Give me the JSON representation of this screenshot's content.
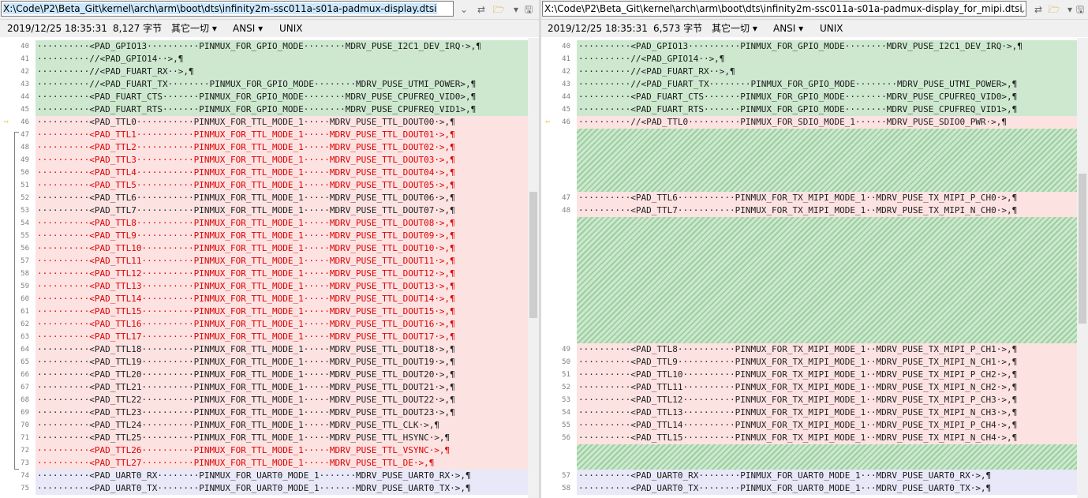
{
  "left": {
    "path": "X:\\Code\\P2\\Beta_Git\\kernel\\arch\\arm\\boot\\dts\\infinity2m-ssc011a-s01a-padmux-display.dtsi",
    "date": "2019/12/25 18:35:31",
    "size": "8,127 字节",
    "charset_menu": "其它一切 ▾",
    "encoding_menu": "ANSI ▾",
    "lineend": "UNIX",
    "lines": [
      {
        "n": "40",
        "t": "··········<PAD_GPIO13··········PINMUX_FOR_GPIO_MODE········MDRV_PUSE_I2C1_DEV_IRQ·>,¶",
        "k": "same"
      },
      {
        "n": "41",
        "t": "··········//<PAD_GPIO14··>,¶",
        "k": "same"
      },
      {
        "n": "42",
        "t": "··········//<PAD_FUART_RX··>,¶",
        "k": "same"
      },
      {
        "n": "43",
        "t": "··········//<PAD_FUART_TX········PINMUX_FOR_GPIO_MODE········MDRV_PUSE_UTMI_POWER>,¶",
        "k": "same"
      },
      {
        "n": "44",
        "t": "··········<PAD_FUART_CTS·······PINMUX_FOR_GPIO_MODE········MDRV_PUSE_CPUFREQ_VID0>,¶",
        "k": "same"
      },
      {
        "n": "45",
        "t": "··········<PAD_FUART_RTS·······PINMUX_FOR_GPIO_MODE········MDRV_PUSE_CPUFREQ_VID1>,¶",
        "k": "same"
      },
      {
        "n": "46",
        "t": "··········<PAD_TTL0···········PINMUX_FOR_TTL_MODE_1·····MDRV_PUSE_TTL_DOUT00·>,¶",
        "k": "diff"
      },
      {
        "n": "47",
        "t": "··········<PAD_TTL1···········PINMUX_FOR_TTL_MODE_1·····MDRV_PUSE_TTL_DOUT01·>,¶",
        "k": "diff red"
      },
      {
        "n": "48",
        "t": "··········<PAD_TTL2···········PINMUX_FOR_TTL_MODE_1·····MDRV_PUSE_TTL_DOUT02·>,¶",
        "k": "diff red"
      },
      {
        "n": "49",
        "t": "··········<PAD_TTL3···········PINMUX_FOR_TTL_MODE_1·····MDRV_PUSE_TTL_DOUT03·>,¶",
        "k": "diff red"
      },
      {
        "n": "50",
        "t": "··········<PAD_TTL4···········PINMUX_FOR_TTL_MODE_1·····MDRV_PUSE_TTL_DOUT04·>,¶",
        "k": "diff red"
      },
      {
        "n": "51",
        "t": "··········<PAD_TTL5···········PINMUX_FOR_TTL_MODE_1·····MDRV_PUSE_TTL_DOUT05·>,¶",
        "k": "diff red"
      },
      {
        "n": "52",
        "t": "··········<PAD_TTL6···········PINMUX_FOR_TTL_MODE_1·····MDRV_PUSE_TTL_DOUT06·>,¶",
        "k": "diff"
      },
      {
        "n": "53",
        "t": "··········<PAD_TTL7···········PINMUX_FOR_TTL_MODE_1·····MDRV_PUSE_TTL_DOUT07·>,¶",
        "k": "diff"
      },
      {
        "n": "54",
        "t": "··········<PAD_TTL8···········PINMUX_FOR_TTL_MODE_1·····MDRV_PUSE_TTL_DOUT08·>,¶",
        "k": "diff red"
      },
      {
        "n": "55",
        "t": "··········<PAD_TTL9···········PINMUX_FOR_TTL_MODE_1·····MDRV_PUSE_TTL_DOUT09·>,¶",
        "k": "diff red"
      },
      {
        "n": "56",
        "t": "··········<PAD_TTL10··········PINMUX_FOR_TTL_MODE_1·····MDRV_PUSE_TTL_DOUT10·>,¶",
        "k": "diff red"
      },
      {
        "n": "57",
        "t": "··········<PAD_TTL11··········PINMUX_FOR_TTL_MODE_1·····MDRV_PUSE_TTL_DOUT11·>,¶",
        "k": "diff red"
      },
      {
        "n": "58",
        "t": "··········<PAD_TTL12··········PINMUX_FOR_TTL_MODE_1·····MDRV_PUSE_TTL_DOUT12·>,¶",
        "k": "diff red"
      },
      {
        "n": "59",
        "t": "··········<PAD_TTL13··········PINMUX_FOR_TTL_MODE_1·····MDRV_PUSE_TTL_DOUT13·>,¶",
        "k": "diff red"
      },
      {
        "n": "60",
        "t": "··········<PAD_TTL14··········PINMUX_FOR_TTL_MODE_1·····MDRV_PUSE_TTL_DOUT14·>,¶",
        "k": "diff red"
      },
      {
        "n": "61",
        "t": "··········<PAD_TTL15··········PINMUX_FOR_TTL_MODE_1·····MDRV_PUSE_TTL_DOUT15·>,¶",
        "k": "diff red"
      },
      {
        "n": "62",
        "t": "··········<PAD_TTL16··········PINMUX_FOR_TTL_MODE_1·····MDRV_PUSE_TTL_DOUT16·>,¶",
        "k": "diff red"
      },
      {
        "n": "63",
        "t": "··········<PAD_TTL17··········PINMUX_FOR_TTL_MODE_1·····MDRV_PUSE_TTL_DOUT17·>,¶",
        "k": "diff red"
      },
      {
        "n": "64",
        "t": "··········<PAD_TTL18··········PINMUX_FOR_TTL_MODE_1·····MDRV_PUSE_TTL_DOUT18·>,¶",
        "k": "diff"
      },
      {
        "n": "65",
        "t": "··········<PAD_TTL19··········PINMUX_FOR_TTL_MODE_1·····MDRV_PUSE_TTL_DOUT19·>,¶",
        "k": "diff"
      },
      {
        "n": "66",
        "t": "··········<PAD_TTL20··········PINMUX_FOR_TTL_MODE_1·····MDRV_PUSE_TTL_DOUT20·>,¶",
        "k": "diff"
      },
      {
        "n": "67",
        "t": "··········<PAD_TTL21··········PINMUX_FOR_TTL_MODE_1·····MDRV_PUSE_TTL_DOUT21·>,¶",
        "k": "diff"
      },
      {
        "n": "68",
        "t": "··········<PAD_TTL22··········PINMUX_FOR_TTL_MODE_1·····MDRV_PUSE_TTL_DOUT22·>,¶",
        "k": "diff"
      },
      {
        "n": "69",
        "t": "··········<PAD_TTL23··········PINMUX_FOR_TTL_MODE_1·····MDRV_PUSE_TTL_DOUT23·>,¶",
        "k": "diff"
      },
      {
        "n": "70",
        "t": "··········<PAD_TTL24··········PINMUX_FOR_TTL_MODE_1·····MDRV_PUSE_TTL_CLK·>,¶",
        "k": "diff"
      },
      {
        "n": "71",
        "t": "··········<PAD_TTL25··········PINMUX_FOR_TTL_MODE_1·····MDRV_PUSE_TTL_HSYNC·>,¶",
        "k": "diff"
      },
      {
        "n": "72",
        "t": "··········<PAD_TTL26··········PINMUX_FOR_TTL_MODE_1·····MDRV_PUSE_TTL_VSYNC·>,¶",
        "k": "diff red"
      },
      {
        "n": "73",
        "t": "··········<PAD_TTL27··········PINMUX_FOR_TTL_MODE_1·····MDRV_PUSE_TTL_DE·>,¶",
        "k": "diff red"
      },
      {
        "n": "74",
        "t": "··········<PAD_UART0_RX········PINMUX_FOR_UART0_MODE_1·······MDRV_PUSE_UART0_RX·>,¶",
        "k": "lite"
      },
      {
        "n": "75",
        "t": "··········<PAD_UART0_TX········PINMUX_FOR_UART0_MODE_1·······MDRV_PUSE_UART0_TX·>,¶",
        "k": "lite"
      }
    ]
  },
  "right": {
    "path": "X:\\Code\\P2\\Beta_Git\\kernel\\arch\\arm\\boot\\dts\\infinity2m-ssc011a-s01a-padmux-display_for_mipi.dtsi",
    "date": "2019/12/25 18:35:31",
    "size": "6,573 字节",
    "charset_menu": "其它一切 ▾",
    "encoding_menu": "ANSI ▾",
    "lineend": "UNIX",
    "lines": [
      {
        "n": "40",
        "t": "··········<PAD_GPIO13··········PINMUX_FOR_GPIO_MODE········MDRV_PUSE_I2C1_DEV_IRQ·>,¶",
        "k": "same",
        "slot": 0
      },
      {
        "n": "41",
        "t": "··········//<PAD_GPIO14··>,¶",
        "k": "same",
        "slot": 1
      },
      {
        "n": "42",
        "t": "··········//<PAD_FUART_RX··>,¶",
        "k": "same",
        "slot": 2
      },
      {
        "n": "43",
        "t": "··········//<PAD_FUART_TX········PINMUX_FOR_GPIO_MODE········MDRV_PUSE_UTMI_POWER>,¶",
        "k": "same",
        "slot": 3
      },
      {
        "n": "44",
        "t": "··········<PAD_FUART_CTS·······PINMUX_FOR_GPIO_MODE········MDRV_PUSE_CPUFREQ_VID0>,¶",
        "k": "same",
        "slot": 4
      },
      {
        "n": "45",
        "t": "··········<PAD_FUART_RTS·······PINMUX_FOR_GPIO_MODE········MDRV_PUSE_CPUFREQ_VID1>,¶",
        "k": "same",
        "slot": 5
      },
      {
        "n": "46",
        "t": "··········//<PAD_TTL0··········PINMUX_FOR_SDIO_MODE_1······MDRV_PUSE_SDIO0_PWR·>,¶",
        "k": "diff",
        "slot": 6
      },
      {
        "n": "47",
        "t": "··········<PAD_TTL6···········PINMUX_FOR_TX_MIPI_MODE_1··MDRV_PUSE_TX_MIPI_P_CH0·>,¶",
        "k": "diff",
        "slot": 12
      },
      {
        "n": "48",
        "t": "··········<PAD_TTL7···········PINMUX_FOR_TX_MIPI_MODE_1··MDRV_PUSE_TX_MIPI_N_CH0·>,¶",
        "k": "diff",
        "slot": 13
      },
      {
        "n": "49",
        "t": "··········<PAD_TTL8···········PINMUX_FOR_TX_MIPI_MODE_1··MDRV_PUSE_TX_MIPI_P_CH1·>,¶",
        "k": "diff",
        "slot": 24
      },
      {
        "n": "50",
        "t": "··········<PAD_TTL9···········PINMUX_FOR_TX_MIPI_MODE_1··MDRV_PUSE_TX_MIPI_N_CH1·>,¶",
        "k": "diff",
        "slot": 25
      },
      {
        "n": "51",
        "t": "··········<PAD_TTL10··········PINMUX_FOR_TX_MIPI_MODE_1··MDRV_PUSE_TX_MIPI_P_CH2·>,¶",
        "k": "diff",
        "slot": 26
      },
      {
        "n": "52",
        "t": "··········<PAD_TTL11··········PINMUX_FOR_TX_MIPI_MODE_1··MDRV_PUSE_TX_MIPI_N_CH2·>,¶",
        "k": "diff",
        "slot": 27
      },
      {
        "n": "53",
        "t": "··········<PAD_TTL12··········PINMUX_FOR_TX_MIPI_MODE_1··MDRV_PUSE_TX_MIPI_P_CH3·>,¶",
        "k": "diff",
        "slot": 28
      },
      {
        "n": "54",
        "t": "··········<PAD_TTL13··········PINMUX_FOR_TX_MIPI_MODE_1··MDRV_PUSE_TX_MIPI_N_CH3·>,¶",
        "k": "diff",
        "slot": 29
      },
      {
        "n": "55",
        "t": "··········<PAD_TTL14··········PINMUX_FOR_TX_MIPI_MODE_1··MDRV_PUSE_TX_MIPI_P_CH4·>,¶",
        "k": "diff",
        "slot": 30
      },
      {
        "n": "56",
        "t": "··········<PAD_TTL15··········PINMUX_FOR_TX_MIPI_MODE_1··MDRV_PUSE_TX_MIPI_N_CH4·>,¶",
        "k": "diff",
        "slot": 31
      },
      {
        "n": "57",
        "t": "··········<PAD_UART0_RX········PINMUX_FOR_UART0_MODE_1···MDRV_PUSE_UART0_RX·>,¶",
        "k": "lite",
        "slot": 34
      },
      {
        "n": "58",
        "t": "··········<PAD_UART0_TX········PINMUX_FOR_UART0_MODE_1···MDRV_PUSE_UART0_TX·>,¶",
        "k": "lite",
        "slot": 35
      }
    ],
    "fillers": [
      [
        7,
        12
      ],
      [
        14,
        24
      ],
      [
        32,
        34
      ]
    ]
  },
  "icons": {
    "dropdown": "chevron-down-icon",
    "swap": "swap-icon",
    "open": "folder-icon",
    "save": "save-icon",
    "current_diff": "arrow-right-icon"
  },
  "colors": {
    "same": "#cde8cf",
    "diff": "#fde2e2",
    "lite": "#e8e8f8",
    "path_highlight": "#cce8ff",
    "arrow": "#e8b400"
  }
}
